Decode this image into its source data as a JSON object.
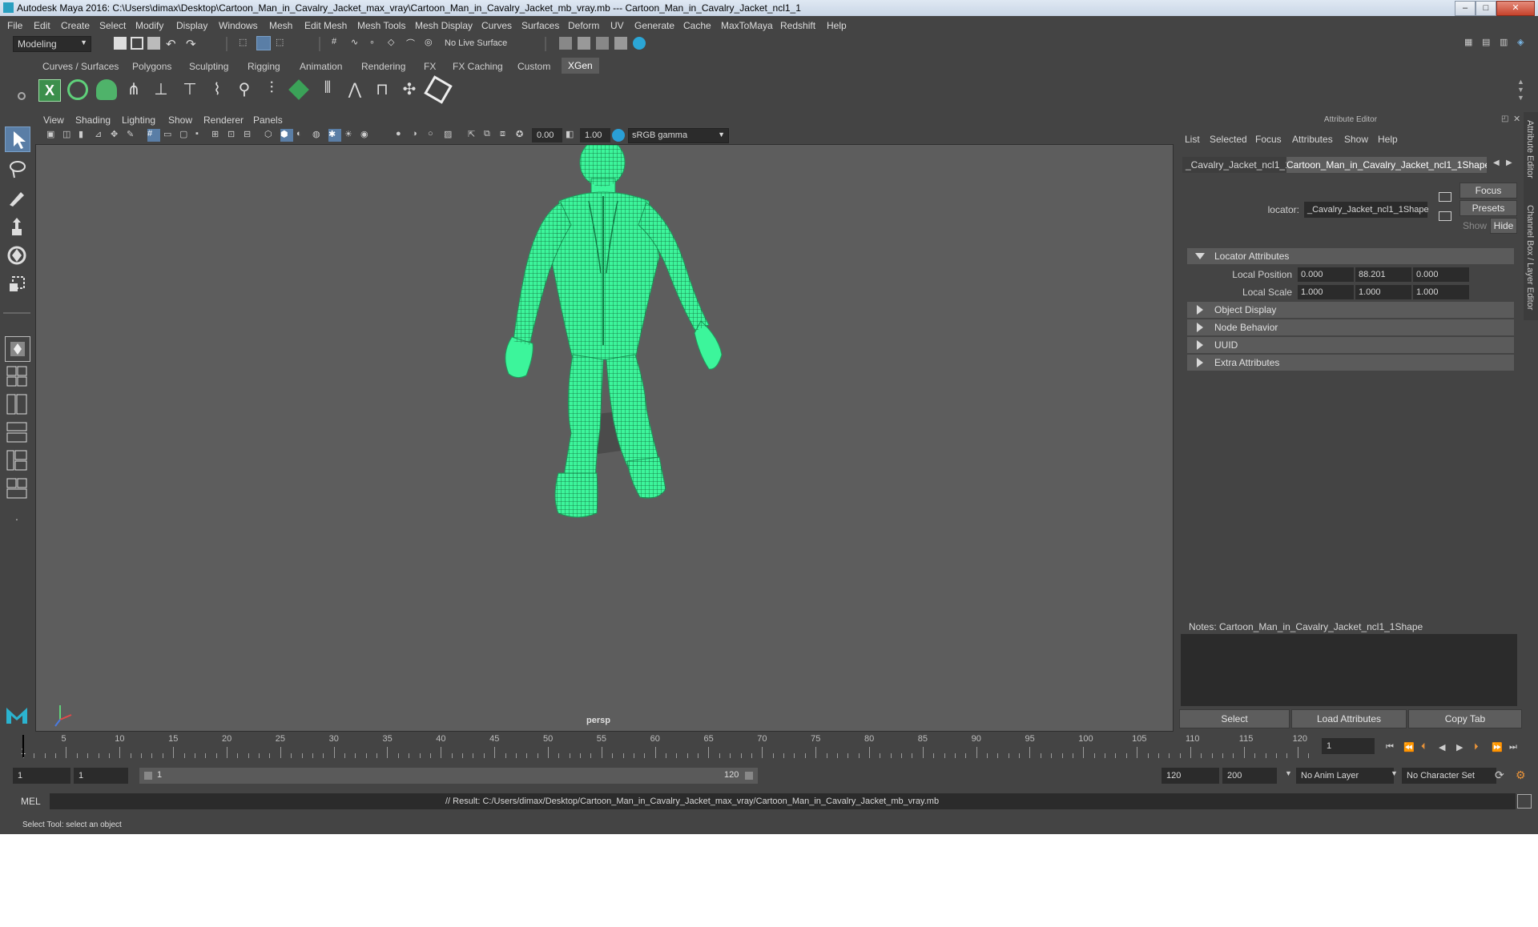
{
  "titlebar": {
    "text": "Autodesk Maya 2016: C:\\Users\\dimax\\Desktop\\Cartoon_Man_in_Cavalry_Jacket_max_vray\\Cartoon_Man_in_Cavalry_Jacket_mb_vray.mb   ---   Cartoon_Man_in_Cavalry_Jacket_ncl1_1",
    "min": "–",
    "max": "□",
    "close": "✕"
  },
  "menubar": [
    "File",
    "Edit",
    "Create",
    "Select",
    "Modify",
    "Display",
    "Windows",
    "Mesh",
    "Edit Mesh",
    "Mesh Tools",
    "Mesh Display",
    "Curves",
    "Surfaces",
    "Deform",
    "UV",
    "Generate",
    "Cache",
    "MaxToMaya",
    "Redshift",
    "Help"
  ],
  "statusline": {
    "mode": "Modeling",
    "live_surface": "No Live Surface"
  },
  "shelf": {
    "tabs": [
      "Curves / Surfaces",
      "Polygons",
      "Sculpting",
      "Rigging",
      "Animation",
      "Rendering",
      "FX",
      "FX Caching",
      "Custom",
      "XGen"
    ],
    "active": "XGen"
  },
  "viewport": {
    "menu": [
      "View",
      "Shading",
      "Lighting",
      "Show",
      "Renderer",
      "Panels"
    ],
    "exposure": "0.00",
    "gamma": "1.00",
    "colorspace": "sRGB gamma",
    "camera_label": "persp"
  },
  "attribute_editor": {
    "title": "Attribute Editor",
    "menu": [
      "List",
      "Selected",
      "Focus",
      "Attributes",
      "Show",
      "Help"
    ],
    "tab_left": "_Cavalry_Jacket_ncl1_1",
    "tab_active": "Cartoon_Man_in_Cavalry_Jacket_ncl1_1Shape",
    "type_label": "locator:",
    "node_name": "_Cavalry_Jacket_ncl1_1Shape",
    "focus_btn": "Focus",
    "presets_btn": "Presets",
    "show_btn": "Show",
    "hide_btn": "Hide",
    "sections": [
      {
        "label": "Locator Attributes",
        "open": true
      },
      {
        "label": "Object Display",
        "open": false
      },
      {
        "label": "Node Behavior",
        "open": false
      },
      {
        "label": "UUID",
        "open": false
      },
      {
        "label": "Extra Attributes",
        "open": false
      }
    ],
    "local_position": {
      "label": "Local Position",
      "x": "0.000",
      "y": "88.201",
      "z": "0.000"
    },
    "local_scale": {
      "label": "Local Scale",
      "x": "1.000",
      "y": "1.000",
      "z": "1.000"
    },
    "notes_label": "Notes:  Cartoon_Man_in_Cavalry_Jacket_ncl1_1Shape",
    "buttons": {
      "select": "Select",
      "load": "Load Attributes",
      "copy": "Copy Tab"
    }
  },
  "vertical_tabs": [
    "Attribute Editor",
    "Channel Box / Layer Editor"
  ],
  "timeline": {
    "ticks": [
      "5",
      "10",
      "15",
      "20",
      "25",
      "30",
      "35",
      "40",
      "45",
      "50",
      "55",
      "60",
      "65",
      "70",
      "75",
      "80",
      "85",
      "90",
      "95",
      "100",
      "105",
      "110",
      "115",
      "120"
    ],
    "start_marker": "1",
    "current_frame": "1"
  },
  "range": {
    "start": "1",
    "playback_start": "1",
    "slider_start": "1",
    "slider_end": "120",
    "playback_end": "120",
    "end": "200",
    "anim_layer": "No Anim Layer",
    "character_set": "No Character Set"
  },
  "command": {
    "lang": "MEL",
    "result": "// Result: C:/Users/dimax/Desktop/Cartoon_Man_in_Cavalry_Jacket_max_vray/Cartoon_Man_in_Cavalry_Jacket_mb_vray.mb"
  },
  "helpline": "Select Tool: select an object",
  "colors": {
    "wire": "#3cf59b",
    "accent": "#5a7ea6",
    "bg": "#444444",
    "viewport": "#5d5d5d"
  }
}
